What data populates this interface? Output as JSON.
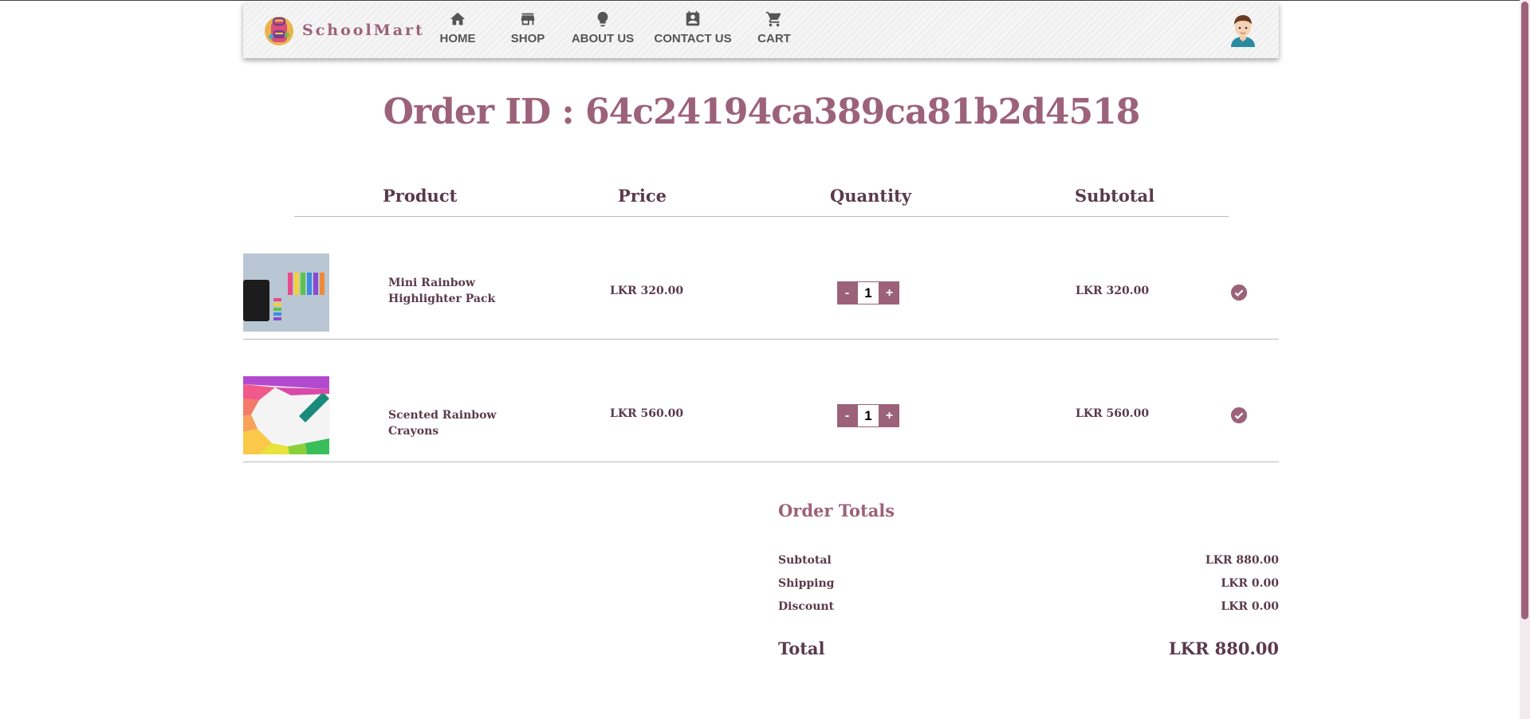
{
  "brand": {
    "name": "SchoolMart"
  },
  "nav": {
    "items": [
      {
        "label": "HOME",
        "icon": "home-icon"
      },
      {
        "label": "SHOP",
        "icon": "store-icon"
      },
      {
        "label": "ABOUT US",
        "icon": "lightbulb-icon"
      },
      {
        "label": "CONTACT US",
        "icon": "contact-card-icon"
      },
      {
        "label": "CART",
        "icon": "cart-icon"
      }
    ]
  },
  "page": {
    "title": "Order ID : 64c24194ca389ca81b2d4518"
  },
  "table": {
    "headers": {
      "product": "Product",
      "price": "Price",
      "quantity": "Quantity",
      "subtotal": "Subtotal"
    },
    "rows": [
      {
        "name": "Mini Rainbow Highlighter Pack",
        "price": "LKR 320.00",
        "quantity": "1",
        "subtotal": "LKR 320.00"
      },
      {
        "name": "Scented Rainbow Crayons",
        "price": "LKR 560.00",
        "quantity": "1",
        "subtotal": "LKR 560.00"
      }
    ],
    "minus_label": "-",
    "plus_label": "+"
  },
  "totals": {
    "title": "Order Totals",
    "subtotal_label": "Subtotal",
    "subtotal_value": "LKR 880.00",
    "shipping_label": "Shipping",
    "shipping_value": "LKR 0.00",
    "discount_label": "Discount",
    "discount_value": "LKR 0.00",
    "total_label": "Total",
    "total_value": "LKR 880.00"
  },
  "colors": {
    "accent": "#9c6279",
    "text": "#5a3a4a",
    "nav_text": "#555555"
  }
}
